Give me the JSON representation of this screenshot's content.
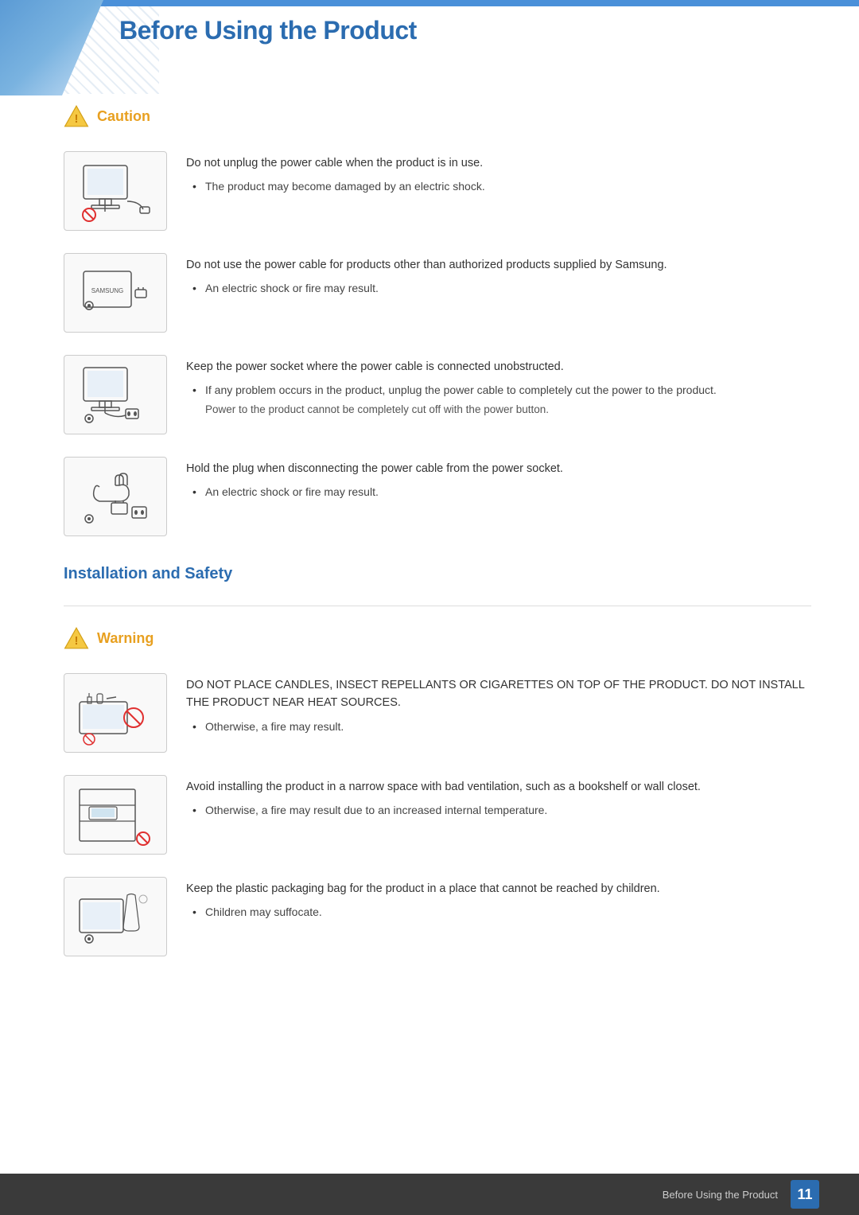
{
  "page": {
    "title": "Before Using the Product",
    "page_number": "11",
    "footer_text": "Before Using the Product"
  },
  "caution_section": {
    "label": "Caution",
    "items": [
      {
        "id": "caution-1",
        "main_text": "Do not unplug the power cable when the product is in use.",
        "bullets": [
          "The product may become damaged by an electric shock."
        ],
        "sub_note": ""
      },
      {
        "id": "caution-2",
        "main_text": "Do not use the power cable for products other than authorized products supplied by Samsung.",
        "bullets": [
          "An electric shock or fire may result."
        ],
        "sub_note": ""
      },
      {
        "id": "caution-3",
        "main_text": "Keep the power socket where the power cable is connected unobstructed.",
        "bullets": [
          "If any problem occurs in the product, unplug the power cable to completely cut the power to the product."
        ],
        "sub_note": "Power to the product cannot be completely cut off with the power button."
      },
      {
        "id": "caution-4",
        "main_text": "Hold the plug when disconnecting the power cable from the power socket.",
        "bullets": [
          "An electric shock or fire may result."
        ],
        "sub_note": ""
      }
    ]
  },
  "installation_section": {
    "label": "Installation and Safety"
  },
  "warning_section": {
    "label": "Warning",
    "items": [
      {
        "id": "warning-1",
        "main_text": "DO NOT PLACE CANDLES, INSECT REPELLANTS OR CIGARETTES ON TOP OF THE PRODUCT. DO NOT INSTALL THE PRODUCT NEAR HEAT SOURCES.",
        "bullets": [
          "Otherwise, a fire may result."
        ]
      },
      {
        "id": "warning-2",
        "main_text": "Avoid installing the product in a narrow space with bad ventilation, such as a bookshelf or wall closet.",
        "bullets": [
          "Otherwise, a fire may result due to an increased internal temperature."
        ]
      },
      {
        "id": "warning-3",
        "main_text": "Keep the plastic packaging bag for the product in a place that cannot be reached by children.",
        "bullets": [
          "Children may suffocate."
        ]
      }
    ]
  }
}
